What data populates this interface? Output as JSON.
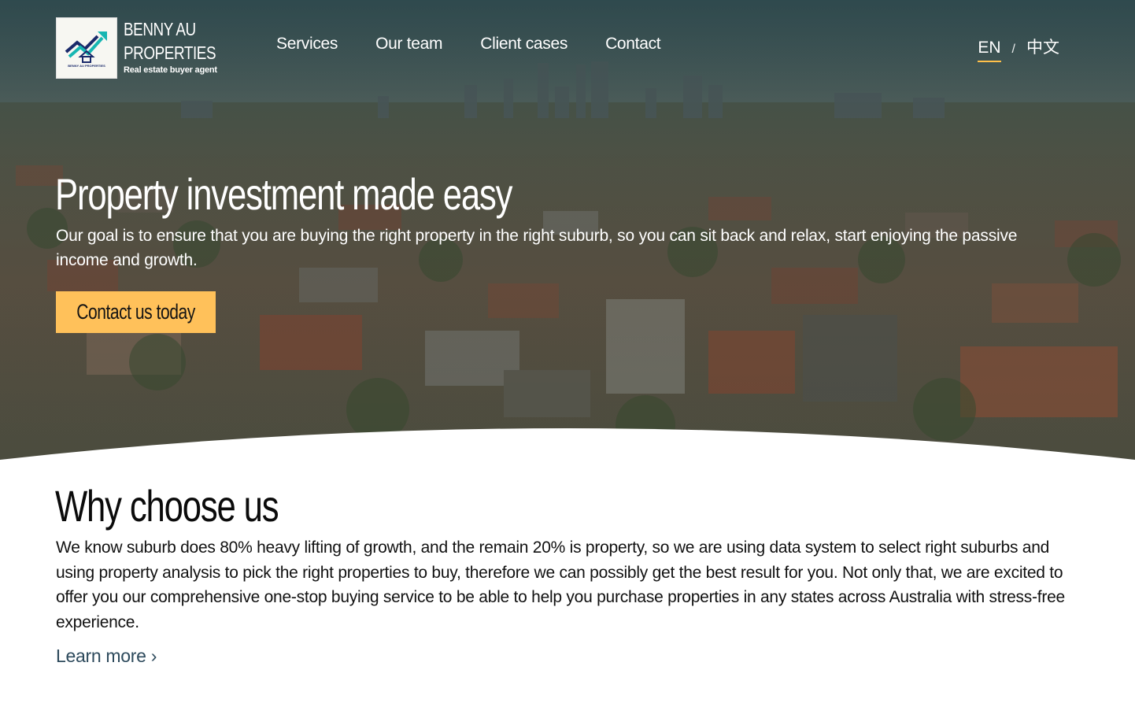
{
  "brand": {
    "name_line1": "BENNY AU",
    "name_line2": "PROPERTIES",
    "tagline": "Real estate buyer agent",
    "logo_caption": "BENNY AU PROPERTIES"
  },
  "nav": {
    "items": [
      {
        "label": "Services"
      },
      {
        "label": "Our team"
      },
      {
        "label": "Client cases"
      },
      {
        "label": "Contact"
      }
    ]
  },
  "language": {
    "active": "EN",
    "separator": "/",
    "alternate": "中文"
  },
  "hero": {
    "title": "Property investment made easy",
    "subtitle": "Our goal is to ensure that you are buying the right property in the right suburb, so you can sit back and relax, start enjoying the passive income and growth.",
    "cta_label": "Contact us today"
  },
  "why": {
    "title": "Why choose us",
    "body": "We know suburb does 80% heavy lifting of growth, and the remain 20% is property, so we are using data system to select right suburbs and using property analysis to pick the right properties to buy, therefore we can possibly get the best result for you. Not only that, we are excited to offer you our comprehensive one-stop buying service to be able to help you purchase properties in any states across Australia with stress-free experience.",
    "link_label": "Learn more ›"
  },
  "colors": {
    "accent": "#ffc15a",
    "underline": "#ffc04a",
    "link": "#2d4a5c",
    "logo_teal": "#16b6b2",
    "logo_navy": "#1a2a6a"
  },
  "icons": {
    "logo": "house-rising-chart-icon"
  }
}
